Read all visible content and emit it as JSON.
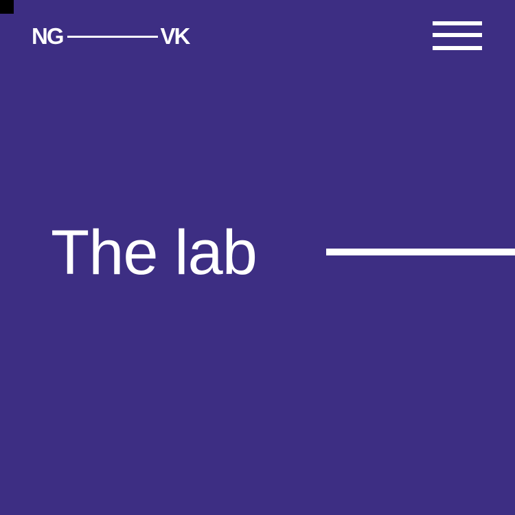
{
  "brand": {
    "logo_left": "NG",
    "logo_right": "VK"
  },
  "header": {
    "menu_icon": "hamburger-menu-icon"
  },
  "hero": {
    "title": "The lab"
  },
  "colors": {
    "background": "#3d2e83",
    "foreground": "#ffffff",
    "corner_mark": "#000000"
  }
}
